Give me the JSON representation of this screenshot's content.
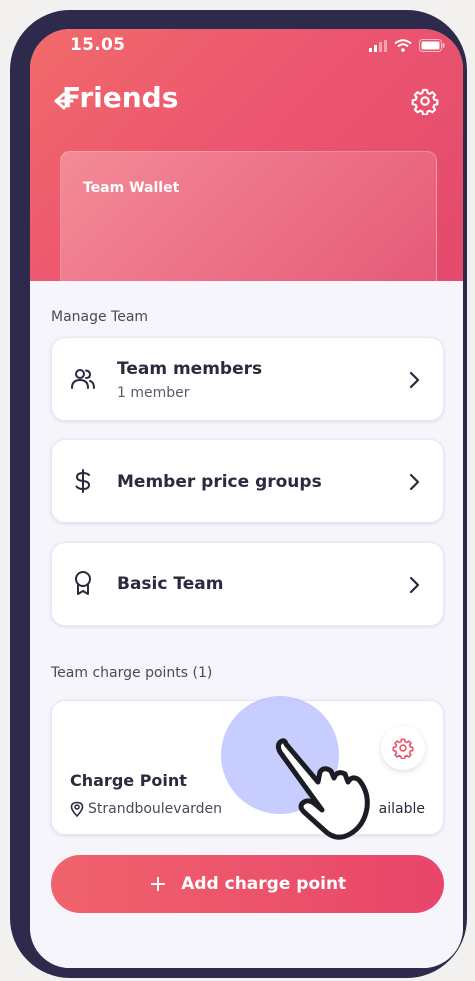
{
  "status_bar": {
    "time": "15.05",
    "icons": [
      "signal-icon",
      "wifi-icon",
      "battery-icon"
    ]
  },
  "header": {
    "title": "Friends",
    "back_icon": "back-arrow-icon",
    "settings_icon": "gear-icon"
  },
  "wallet": {
    "title": "Team Wallet"
  },
  "manage_team": {
    "label": "Manage Team",
    "items": [
      {
        "icon": "users-icon",
        "title": "Team members",
        "subtitle": "1 member"
      },
      {
        "icon": "dollar-icon",
        "title": "Member price groups"
      },
      {
        "icon": "badge-icon",
        "title": "Basic Team"
      }
    ]
  },
  "charge_points": {
    "label": "Team charge points (1)",
    "card": {
      "name": "Charge Point",
      "location": "Strandboulevarden",
      "status": "ailable"
    }
  },
  "add_button": {
    "label": "Add charge point",
    "plus": "+"
  },
  "colors": {
    "accent": "#ec5670",
    "frame": "#2e2a4c",
    "text": "#2b2a3e"
  }
}
